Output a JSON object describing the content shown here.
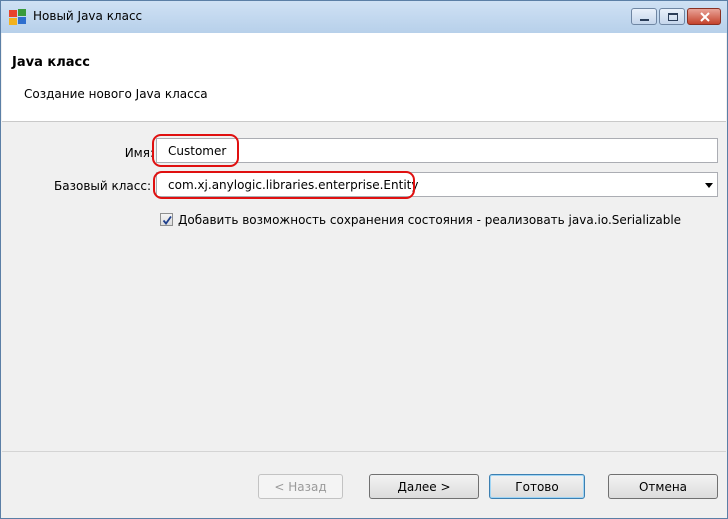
{
  "window": {
    "title": "Новый Java класс",
    "header_title": "Java класс",
    "header_description": "Создание нового Java класса"
  },
  "form": {
    "name_label": "Имя:",
    "name_value": "Customer",
    "base_class_label": "Базовый класс:",
    "base_class_value": "com.xj.anylogic.libraries.enterprise.Entity",
    "serializable_checked": true,
    "serializable_label": "Добавить возможность сохранения состояния  - реализовать java.io.Serializable"
  },
  "buttons": {
    "back": "< Назад",
    "next": "Далее >",
    "finish": "Готово",
    "cancel": "Отмена"
  },
  "colors": {
    "highlight": "#e01010",
    "close_button": "#c4432c"
  }
}
